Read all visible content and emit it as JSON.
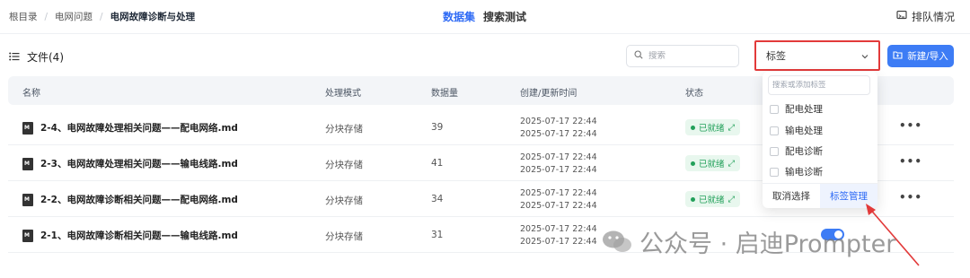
{
  "breadcrumb": {
    "items": [
      "根目录",
      "电网问题",
      "电网故障诊断与处理"
    ],
    "separator": "/"
  },
  "topnav": {
    "tabs": [
      "数据集",
      "搜索测试"
    ]
  },
  "queue": {
    "label": "排队情况"
  },
  "files": {
    "title": "文件(4)"
  },
  "search": {
    "placeholder": "搜索"
  },
  "tag_select": {
    "value": "标签"
  },
  "new_button": {
    "label": "新建/导入"
  },
  "table": {
    "headers": {
      "name": "名称",
      "mode": "处理模式",
      "count": "数据量",
      "time": "创建/更新时间",
      "status": "状态"
    },
    "rows": [
      {
        "name": "2-4、电网故障处理相关问题——配电网络.md",
        "mode": "分块存储",
        "count": "39",
        "created": "2025-07-17 22:44",
        "updated": "2025-07-17 22:44",
        "status": "已就绪"
      },
      {
        "name": "2-3、电网故障处理相关问题——输电线路.md",
        "mode": "分块存储",
        "count": "41",
        "created": "2025-07-17 22:44",
        "updated": "2025-07-17 22:44",
        "status": "已就绪"
      },
      {
        "name": "2-2、电网故障诊断相关问题——配电网络.md",
        "mode": "分块存储",
        "count": "34",
        "created": "2025-07-17 22:44",
        "updated": "2025-07-17 22:44",
        "status": "已就绪"
      },
      {
        "name": "2-1、电网故障诊断相关问题——输电线路.md",
        "mode": "分块存储",
        "count": "31",
        "created": "2025-07-17 22:44",
        "updated": "2025-07-17 22:44",
        "status": ""
      }
    ]
  },
  "dropdown": {
    "search_placeholder": "搜索或添加标签",
    "options": [
      "配电处理",
      "输电处理",
      "配电诊断",
      "输电诊断"
    ],
    "cancel": "取消选择",
    "manage": "标签管理"
  },
  "watermark": {
    "text": "公众号 · 启迪Prompter"
  },
  "colors": {
    "accent": "#3d7cf5",
    "ready": "#22a05a",
    "highlight": "#e23a3a"
  }
}
